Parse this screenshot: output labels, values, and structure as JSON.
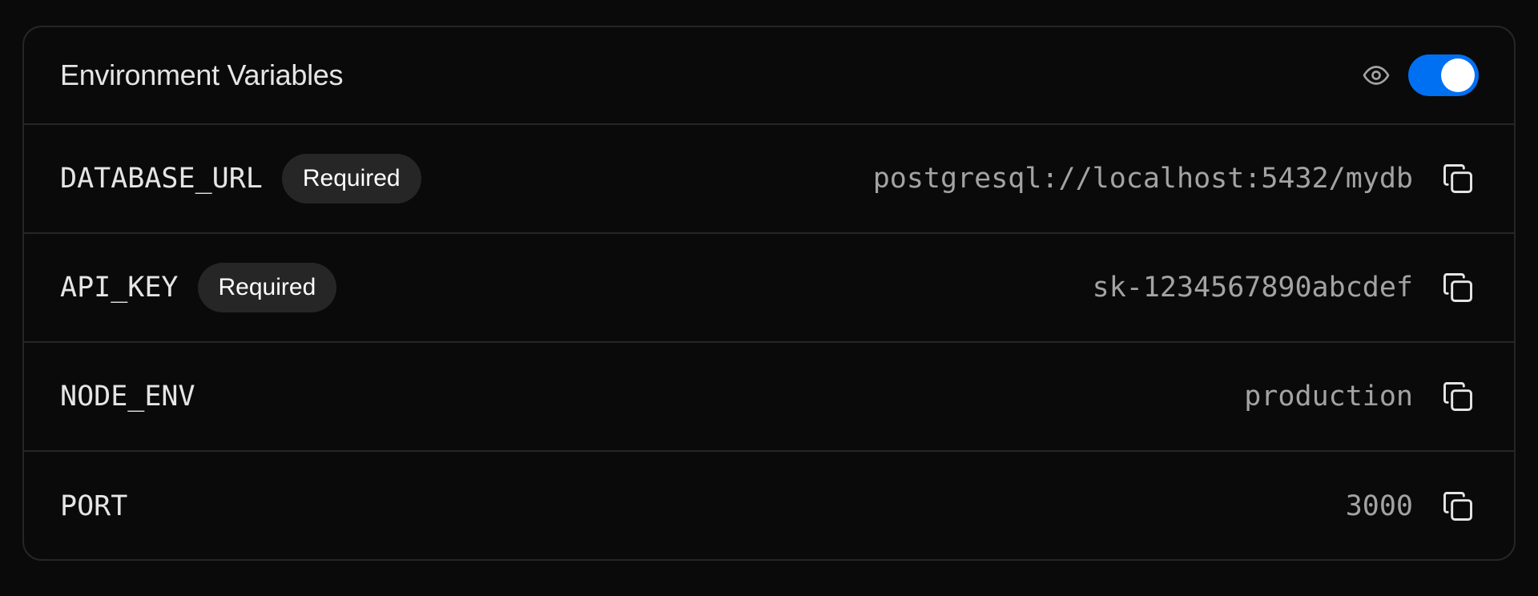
{
  "panel": {
    "title": "Environment Variables",
    "visibility_icon": "eye-icon",
    "toggle": {
      "on": true,
      "color": "#0070f3"
    }
  },
  "variables": [
    {
      "name": "DATABASE_URL",
      "badge": "Required",
      "value": "postgresql://localhost:5432/mydb",
      "copy_icon": "copy-icon"
    },
    {
      "name": "API_KEY",
      "badge": "Required",
      "value": "sk-1234567890abcdef",
      "copy_icon": "copy-icon"
    },
    {
      "name": "NODE_ENV",
      "badge": "",
      "value": "production",
      "copy_icon": "copy-icon"
    },
    {
      "name": "PORT",
      "badge": "",
      "value": "3000",
      "copy_icon": "copy-icon"
    }
  ]
}
